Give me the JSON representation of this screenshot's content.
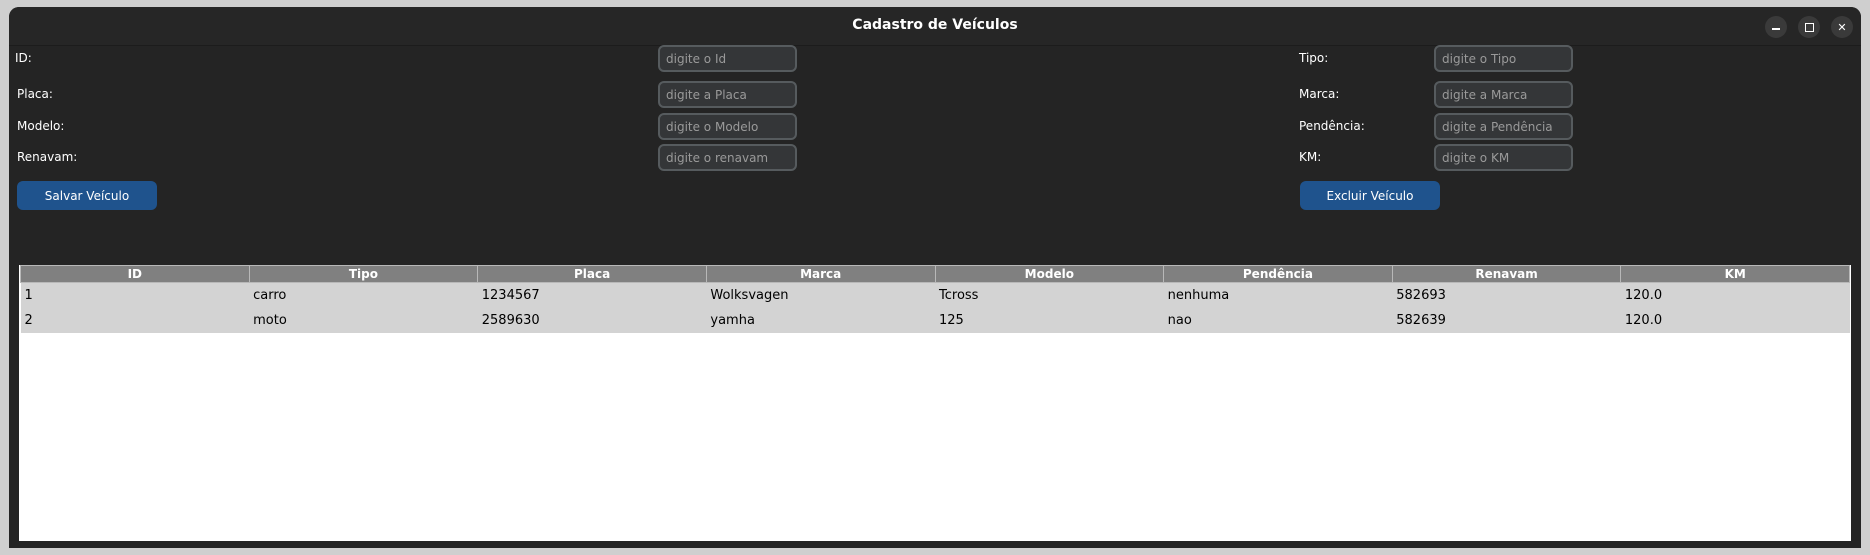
{
  "window": {
    "title": "Cadastro de Veículos"
  },
  "form": {
    "left": [
      {
        "label": "ID:",
        "placeholder": "digite o Id"
      },
      {
        "label": "Placa:",
        "placeholder": "digite a Placa"
      },
      {
        "label": "Modelo:",
        "placeholder": "digite o Modelo"
      },
      {
        "label": "Renavam:",
        "placeholder": "digite o renavam"
      }
    ],
    "right": [
      {
        "label": "Tipo:",
        "placeholder": "digite o Tipo"
      },
      {
        "label": "Marca:",
        "placeholder": "digite a Marca"
      },
      {
        "label": "Pendência:",
        "placeholder": "digite a Pendência"
      },
      {
        "label": "KM:",
        "placeholder": "digite o KM"
      }
    ],
    "save_label": "Salvar Veículo",
    "delete_label": "Excluir Veículo"
  },
  "table": {
    "columns": [
      "ID",
      "Tipo",
      "Placa",
      "Marca",
      "Modelo",
      "Pendência",
      "Renavam",
      "KM"
    ],
    "rows": [
      [
        "1",
        "carro",
        "1234567",
        "Wolksvagen",
        "Tcross",
        "nenhuma",
        "582693",
        "120.0"
      ],
      [
        "2",
        "moto",
        "2589630",
        "yamha",
        "125",
        "nao",
        "582639",
        "120.0"
      ]
    ]
  },
  "colors": {
    "window_bg": "#242424",
    "button_accent": "#1f538d",
    "table_header": "#808080",
    "row_bg": "#d3d3d3"
  }
}
